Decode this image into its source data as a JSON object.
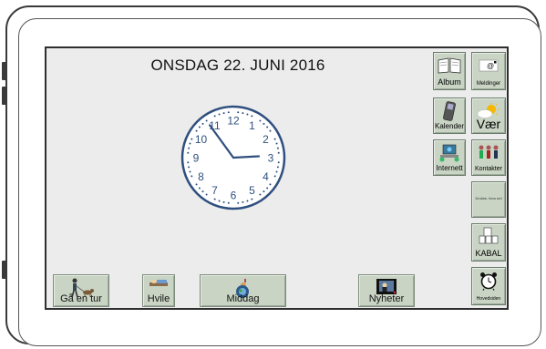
{
  "date_title": "ONSDAG 22. JUNI 2016",
  "clock": {
    "hour": 2,
    "minute": 54,
    "numbers": [
      "12",
      "1",
      "2",
      "3",
      "4",
      "5",
      "6",
      "7",
      "8",
      "9",
      "10",
      "11"
    ]
  },
  "right_tiles": {
    "album": "Album",
    "meldinger": "Meldinger",
    "meldinger_badge": "@",
    "kalender": "Kalender",
    "vaer": "Vær",
    "internett": "Internett",
    "kontakter": "Kontakter",
    "ordtrykk": "Drukke, lima ord",
    "kabal": "KABAL",
    "hovedsiden": "Hovedsiden"
  },
  "bottom_tiles": {
    "ga_en_tur": "Gå en tur",
    "hvile": "Hvile",
    "middag": "Middag",
    "nyheter": "Nyheter"
  },
  "colors": {
    "tile_bg": "#c9d4c4",
    "screen_bg": "#ececec",
    "clock_blue": "#2f4f7f"
  }
}
